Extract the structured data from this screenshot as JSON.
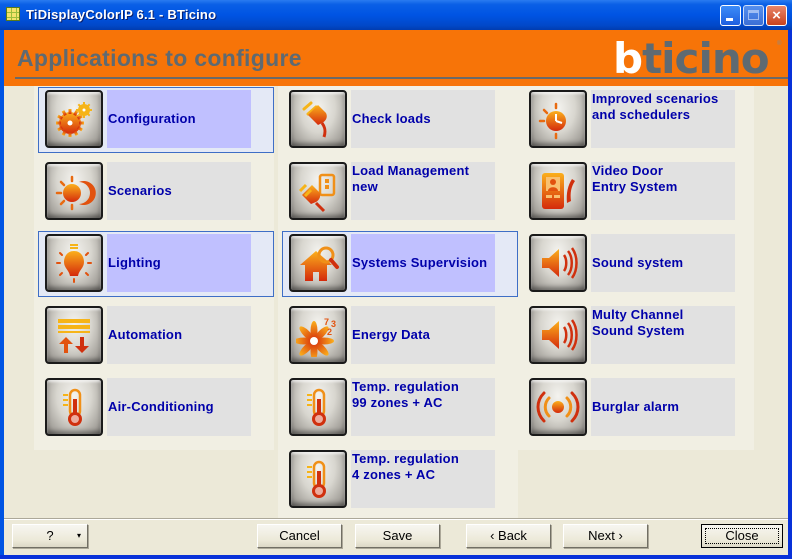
{
  "window": {
    "title": "TiDisplayColorIP 6.1 - BTicino",
    "controls": {
      "minimize": "minimize",
      "maximize": "maximize",
      "close": "×"
    }
  },
  "header": {
    "title": "Applications to configure",
    "logo_b": "b",
    "logo_rest": "ticino",
    "logo_mark": "®",
    "colors": {
      "header_bg": "#F77408",
      "heading_text": "#5E6A72"
    }
  },
  "columns": [
    {
      "items": [
        {
          "id": "configuration",
          "label": [
            "Configuration"
          ],
          "icon": "gears-icon",
          "selected": true
        },
        {
          "id": "scenarios",
          "label": [
            "Scenarios"
          ],
          "icon": "sun-moon-icon",
          "selected": false
        },
        {
          "id": "lighting",
          "label": [
            "Lighting"
          ],
          "icon": "light-bulb-icon",
          "selected": true
        },
        {
          "id": "automation",
          "label": [
            "Automation"
          ],
          "icon": "shutter-arrows-icon",
          "selected": false
        },
        {
          "id": "air-conditioning",
          "label": [
            "Air-Conditioning"
          ],
          "icon": "thermometer-icon",
          "selected": false
        }
      ]
    },
    {
      "items": [
        {
          "id": "check-loads",
          "label": [
            "Check loads"
          ],
          "icon": "plug-icon",
          "selected": false
        },
        {
          "id": "load-management-new",
          "label": [
            "Load Management",
            "new"
          ],
          "icon": "plug-socket-icon",
          "selected": false
        },
        {
          "id": "systems-supervision",
          "label": [
            "Systems Supervision"
          ],
          "icon": "house-magnifier-icon",
          "selected": true
        },
        {
          "id": "energy-data",
          "label": [
            "Energy Data"
          ],
          "icon": "energy-flower-icon",
          "selected": false
        },
        {
          "id": "temp-regulation-99",
          "label": [
            "Temp. regulation",
            "99 zones + AC"
          ],
          "icon": "thermometer-icon",
          "selected": false
        },
        {
          "id": "temp-regulation-4",
          "label": [
            "Temp. regulation",
            "4 zones + AC"
          ],
          "icon": "thermometer-icon",
          "selected": false
        }
      ]
    },
    {
      "items": [
        {
          "id": "improved-scenarios",
          "label": [
            "Improved scenarios",
            "and schedulers"
          ],
          "icon": "sun-clock-icon",
          "selected": false
        },
        {
          "id": "video-door-entry",
          "label": [
            "Video Door",
            "Entry System"
          ],
          "icon": "video-intercom-icon",
          "selected": false
        },
        {
          "id": "sound-system",
          "label": [
            "Sound system"
          ],
          "icon": "speaker-icon",
          "selected": false
        },
        {
          "id": "multy-channel-sound",
          "label": [
            "Multy Channel",
            "Sound System"
          ],
          "icon": "speaker-icon",
          "selected": false
        },
        {
          "id": "burglar-alarm",
          "label": [
            "Burglar alarm"
          ],
          "icon": "alarm-icon",
          "selected": false
        }
      ]
    }
  ],
  "footer": {
    "help": "?",
    "help_arrow": "▾",
    "cancel": "Cancel",
    "save": "Save",
    "back": "‹ Back",
    "next": "Next ›",
    "close": "Close"
  }
}
